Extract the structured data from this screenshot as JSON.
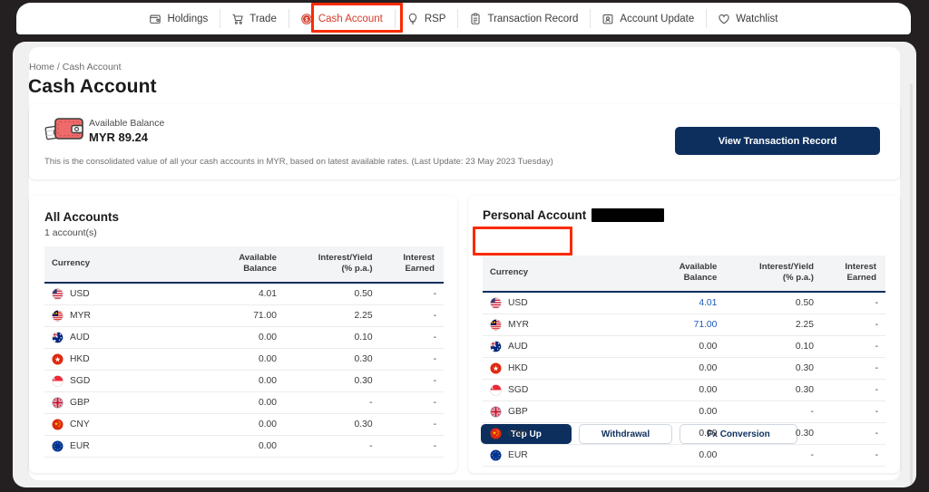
{
  "nav": {
    "items": [
      {
        "label": "Holdings",
        "icon": "wallet-icon",
        "active": false
      },
      {
        "label": "Trade",
        "icon": "shopping-cart-icon",
        "active": false
      },
      {
        "label": "Cash Account",
        "icon": "coin-dollar-icon",
        "active": true
      },
      {
        "label": "RSP",
        "icon": "lightbulb-icon",
        "active": false
      },
      {
        "label": "Transaction Record",
        "icon": "clipboard-icon",
        "active": false
      },
      {
        "label": "Account Update",
        "icon": "person-card-icon",
        "active": false
      },
      {
        "label": "Watchlist",
        "icon": "heart-icon",
        "active": false
      }
    ]
  },
  "breadcrumb": "Home / Cash Account",
  "page_title": "Cash Account",
  "balance_panel": {
    "icon": "wallet-cash-icon",
    "label": "Available Balance",
    "value": "MYR 89.24",
    "note": "This is the consolidated value of all your cash accounts in MYR, based on latest available rates. (Last Update: 23 May 2023 Tuesday)",
    "button_label": "View Transaction Record"
  },
  "all_accounts": {
    "title": "All Accounts",
    "subtitle": "1 account(s)",
    "columns": [
      "Currency",
      "Available\nBalance",
      "Interest/Yield\n(% p.a.)",
      "Interest\nEarned"
    ],
    "columns_flat": {
      "currency": "Currency",
      "balance_l1": "Available",
      "balance_l2": "Balance",
      "interest_l1": "Interest/Yield",
      "interest_l2": "(% p.a.)",
      "earned_l1": "Interest",
      "earned_l2": "Earned"
    },
    "rows": [
      {
        "currency": "USD",
        "flag": "flag-us",
        "balance": "4.01",
        "interest": "0.50",
        "earned": "-"
      },
      {
        "currency": "MYR",
        "flag": "flag-my",
        "balance": "71.00",
        "interest": "2.25",
        "earned": "-"
      },
      {
        "currency": "AUD",
        "flag": "flag-au",
        "balance": "0.00",
        "interest": "0.10",
        "earned": "-"
      },
      {
        "currency": "HKD",
        "flag": "flag-hk",
        "balance": "0.00",
        "interest": "0.30",
        "earned": "-"
      },
      {
        "currency": "SGD",
        "flag": "flag-sg",
        "balance": "0.00",
        "interest": "0.30",
        "earned": "-"
      },
      {
        "currency": "GBP",
        "flag": "flag-gb",
        "balance": "0.00",
        "interest": "-",
        "earned": "-"
      },
      {
        "currency": "CNY",
        "flag": "flag-cn",
        "balance": "0.00",
        "interest": "0.30",
        "earned": "-"
      },
      {
        "currency": "EUR",
        "flag": "flag-eu",
        "balance": "0.00",
        "interest": "-",
        "earned": "-"
      }
    ]
  },
  "personal_account": {
    "title": "Personal Account",
    "redacted": true,
    "actions": [
      {
        "label": "Top Up",
        "style": "primary"
      },
      {
        "label": "Withdrawal",
        "style": "ghost"
      },
      {
        "label": "Fx Conversion",
        "style": "ghost"
      }
    ],
    "columns_flat": {
      "currency": "Currency",
      "balance_l1": "Available",
      "balance_l2": "Balance",
      "interest_l1": "Interest/Yield",
      "interest_l2": "(% p.a.)",
      "earned_l1": "Interest",
      "earned_l2": "Earned"
    },
    "rows": [
      {
        "currency": "USD",
        "flag": "flag-us",
        "balance": "4.01",
        "balance_link": true,
        "interest": "0.50",
        "earned": "-"
      },
      {
        "currency": "MYR",
        "flag": "flag-my",
        "balance": "71.00",
        "balance_link": true,
        "interest": "2.25",
        "earned": "-"
      },
      {
        "currency": "AUD",
        "flag": "flag-au",
        "balance": "0.00",
        "balance_link": false,
        "interest": "0.10",
        "earned": "-"
      },
      {
        "currency": "HKD",
        "flag": "flag-hk",
        "balance": "0.00",
        "balance_link": false,
        "interest": "0.30",
        "earned": "-"
      },
      {
        "currency": "SGD",
        "flag": "flag-sg",
        "balance": "0.00",
        "balance_link": false,
        "interest": "0.30",
        "earned": "-"
      },
      {
        "currency": "GBP",
        "flag": "flag-gb",
        "balance": "0.00",
        "balance_link": false,
        "interest": "-",
        "earned": "-"
      },
      {
        "currency": "CNY",
        "flag": "flag-cn",
        "balance": "0.00",
        "balance_link": false,
        "interest": "0.30",
        "earned": "-"
      },
      {
        "currency": "EUR",
        "flag": "flag-eu",
        "balance": "0.00",
        "balance_link": false,
        "interest": "-",
        "earned": "-"
      }
    ]
  },
  "highlights": {
    "color": "#f92b00",
    "targets": [
      "Cash Account tab",
      "Top Up button"
    ]
  },
  "colors": {
    "accent_red": "#d43a2a",
    "brand_navy": "#0d2f5e",
    "link_blue": "#1a57b8",
    "page_bg": "#f0f0f0",
    "chrome_dark": "#241f20"
  }
}
